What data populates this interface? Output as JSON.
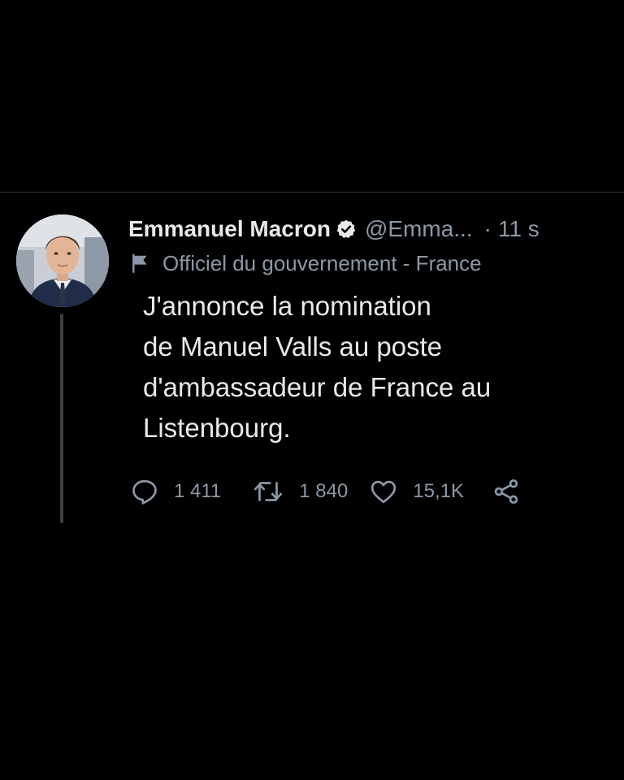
{
  "tweet": {
    "author_name": "Emmanuel Macron",
    "handle": "@Emma...",
    "separator": "·",
    "time": "11 s",
    "label": "Officiel du gouvernement - France",
    "text_lines": [
      "J'annonce la nomination",
      "de Manuel Valls au poste",
      "d'ambassadeur de France au",
      "Listenbourg."
    ],
    "actions": {
      "reply_count": "1 411",
      "retweet_count": "1 840",
      "like_count": "15,1K"
    },
    "icons": {
      "verified": "verified-badge-icon",
      "label": "flag-icon",
      "reply": "reply-icon",
      "retweet": "retweet-icon",
      "like": "heart-icon",
      "share": "share-icon"
    }
  },
  "colors": {
    "background": "#000000",
    "text": "#e7e9ea",
    "secondary_text": "#8b98a5",
    "divider": "#2f3336"
  }
}
